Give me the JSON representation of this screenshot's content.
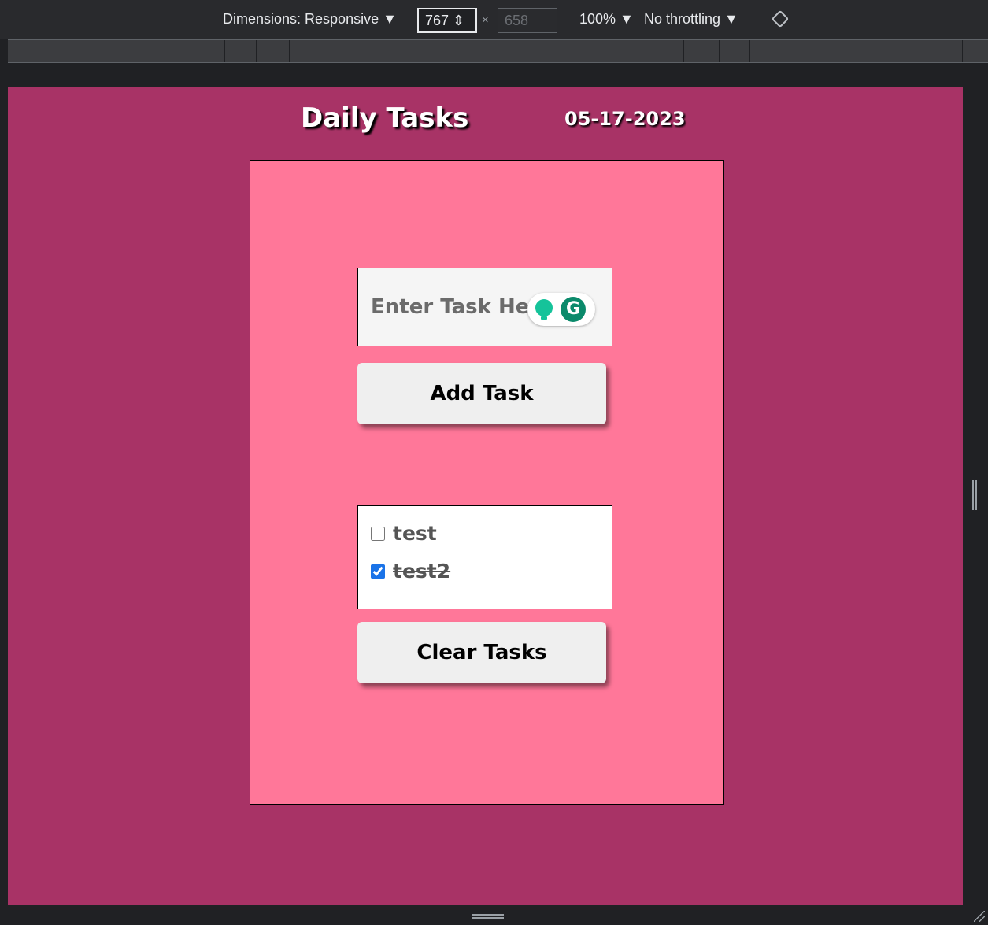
{
  "devtools": {
    "dimensions_label": "Dimensions: Responsive ▼",
    "width_value": "767 ⇕",
    "times_symbol": "×",
    "height_value": "658",
    "zoom_label": "100% ▼",
    "throttling_label": "No throttling ▼",
    "rotate_icon": "rotate-icon"
  },
  "app": {
    "title": "Daily Tasks",
    "date": "05-17-2023",
    "task_input_placeholder": "Enter Task Here",
    "add_button_label": "Add Task",
    "clear_button_label": "Clear Tasks",
    "grammarly_logo": "G",
    "tasks": [
      {
        "label": "test",
        "checked": false
      },
      {
        "label": "test2",
        "checked": true
      }
    ],
    "colors": {
      "page_background": "#a83366",
      "panel_background": "#ff7799",
      "button_background": "#efefef"
    }
  }
}
